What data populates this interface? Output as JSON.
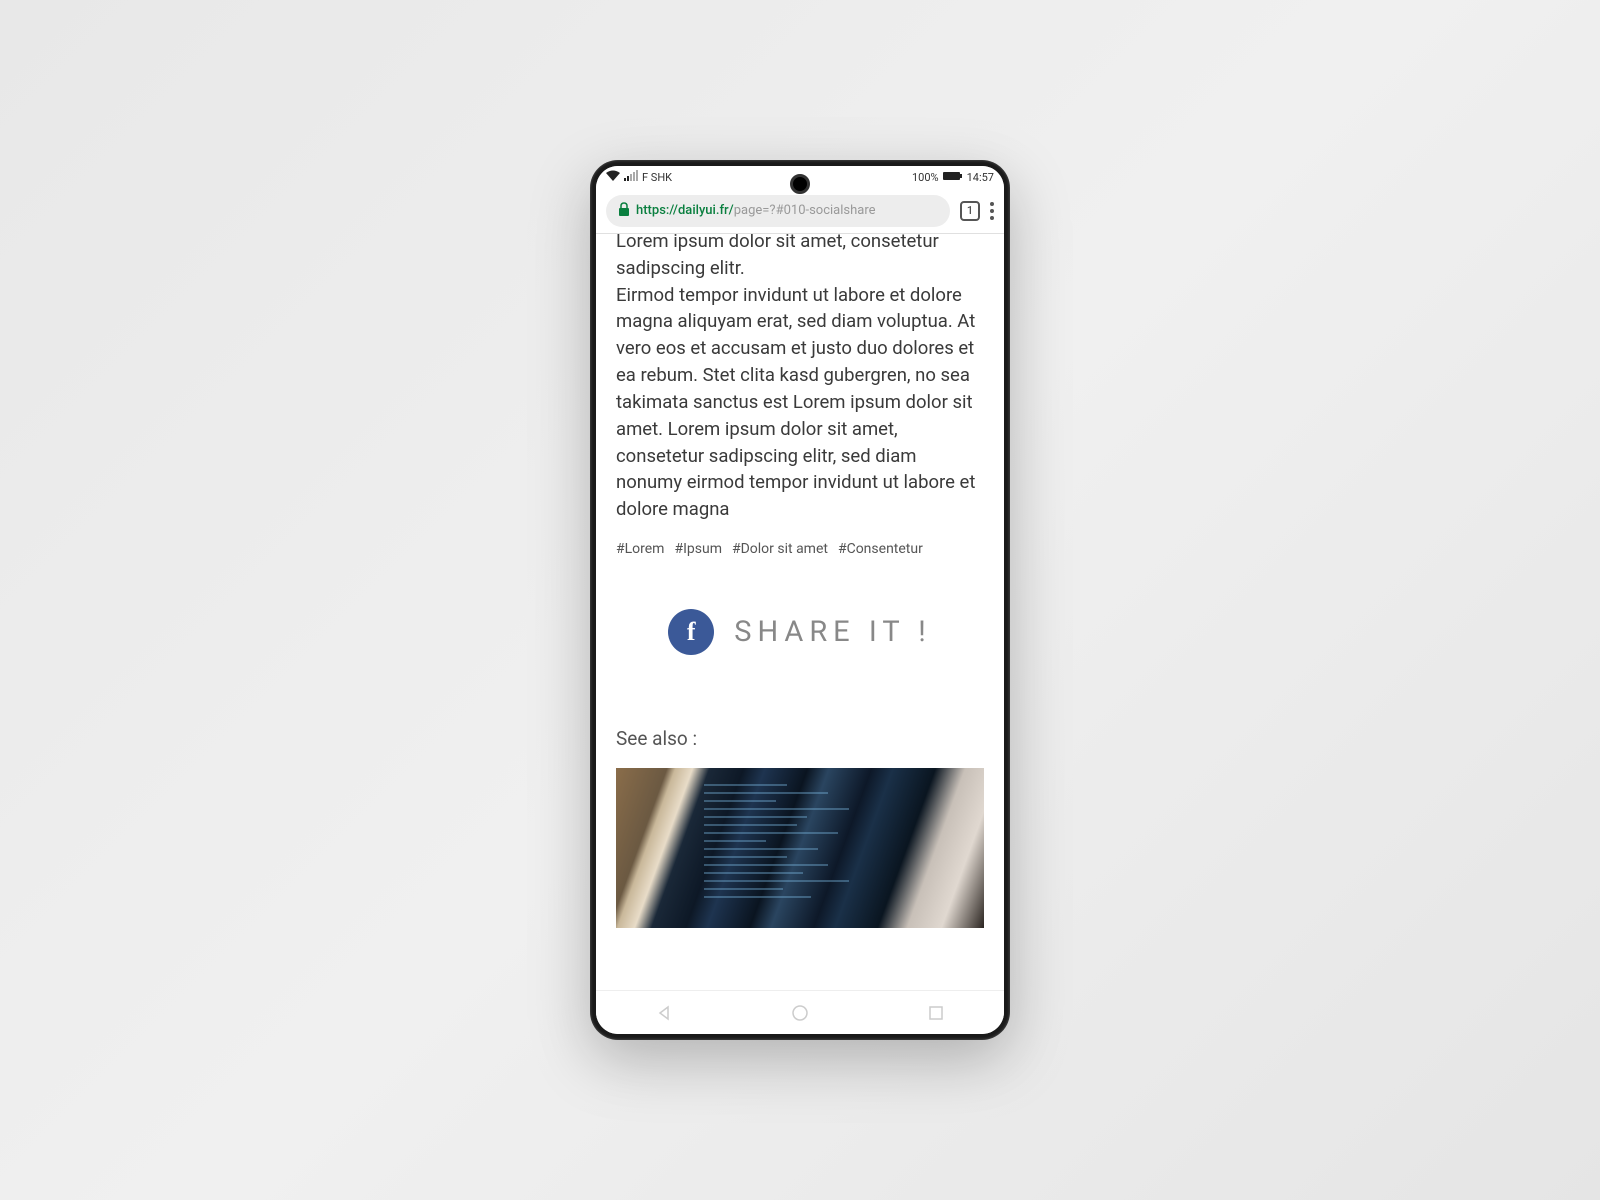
{
  "status": {
    "carrier": "F SHK",
    "battery_pct": "100%",
    "time": "14:57"
  },
  "browser": {
    "scheme": "https://",
    "domain": "dailyui.fr/",
    "path": "page=?#010-socialshare",
    "tab_count": "1"
  },
  "article": {
    "body_line1": "Lorem ipsum dolor sit amet, consetetur sadipscing elitr.",
    "body_line2": " Eirmod tempor invidunt ut labore et dolore magna aliquyam erat, sed diam voluptua. At vero eos et accusam et justo duo dolores et ea rebum. Stet clita kasd gubergren, no sea takimata sanctus est Lorem ipsum dolor sit amet. Lorem ipsum dolor sit amet, consetetur sadipscing elitr, sed diam nonumy eirmod tempor invidunt ut labore et dolore magna"
  },
  "tags": [
    "#Lorem",
    "#Ipsum",
    "#Dolor sit amet",
    "#Consentetur"
  ],
  "share": {
    "fb_letter": "f",
    "label": "SHARE IT !"
  },
  "see_also": {
    "heading": "See also :"
  }
}
